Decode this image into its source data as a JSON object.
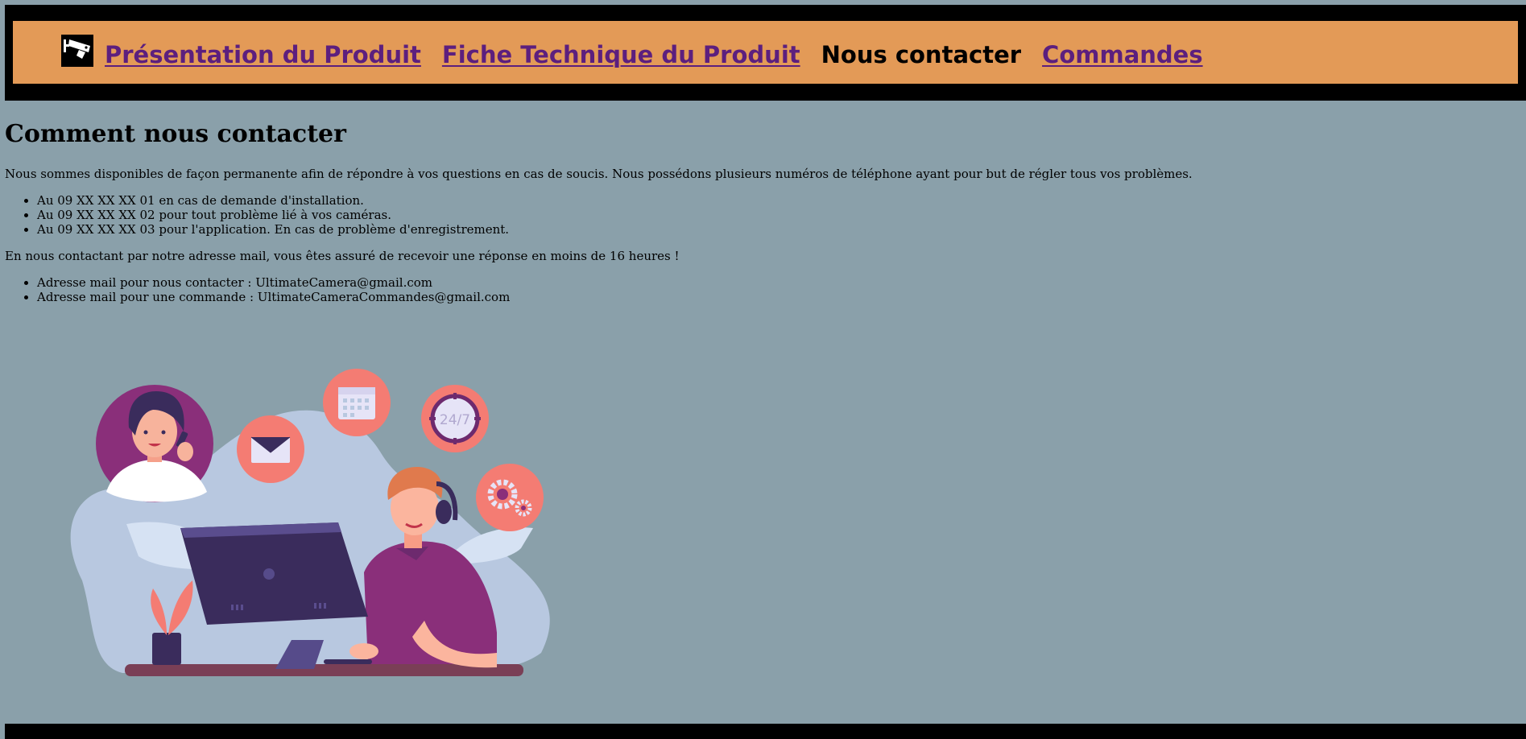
{
  "nav": {
    "logo_icon": "security-camera-icon",
    "links": [
      {
        "label": "Présentation du Produit"
      },
      {
        "label": "Fiche Technique du Produit"
      },
      {
        "label": "Nous contacter"
      },
      {
        "label": "Commandes"
      }
    ]
  },
  "main": {
    "title": "Comment nous contacter",
    "intro": "Nous sommes disponibles de façon permanente afin de répondre à vos questions en cas de soucis. Nous possédons plusieurs numéros de téléphone ayant pour but de régler tous vos problèmes.",
    "phones": [
      "Au 09 XX XX XX 01 en cas de demande d'installation.",
      "Au 09 XX XX XX 02 pour tout problème lié à vos caméras.",
      "Au 09 XX XX XX 03 pour l'application. En cas de problème d'enregistrement."
    ],
    "mail_intro": "En nous contactant par notre adresse mail, vous êtes assuré de recevoir une réponse en moins de 16 heures !",
    "emails": [
      "Adresse mail pour nous contacter : UltimateCamera@gmail.com",
      "Adresse mail pour une commande : UltimateCameraCommandes@gmail.com"
    ],
    "illustration_icons": [
      "woman-on-phone",
      "mail-icon",
      "calendar-icon",
      "clock-24-7-icon",
      "gears-icon",
      "support-agent"
    ],
    "illustration_text": "24/7"
  },
  "colors": {
    "page_bg": "#8aa0aa",
    "nav_bg": "#e39a57",
    "link": "#5c1f7e",
    "accent_salmon": "#f47c73",
    "blob": "#b8c8e0",
    "monitor": "#3a2c5c"
  }
}
